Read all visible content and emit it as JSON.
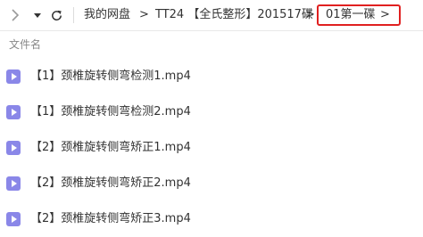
{
  "toolbar": {
    "forward_icon": "chevron-right-icon",
    "dropdown_icon": "caret-down-icon",
    "refresh_icon": "refresh-icon"
  },
  "breadcrumb": {
    "items": [
      "我的网盘",
      "TT24 【全氏整形】201517碟"
    ],
    "separator": ">",
    "current": "01第一碟",
    "current_arrow": ">",
    "highlight_color": "#e02020"
  },
  "header": {
    "column_name": "文件名"
  },
  "files": [
    {
      "name": "【1】颈椎旋转侧弯检测1.mp4"
    },
    {
      "name": "【1】颈椎旋转侧弯检测2.mp4"
    },
    {
      "name": "【2】颈椎旋转侧弯矫正1.mp4"
    },
    {
      "name": "【2】颈椎旋转侧弯矫正2.mp4"
    },
    {
      "name": "【2】颈椎旋转侧弯矫正3.mp4"
    }
  ],
  "colors": {
    "file_icon": "#8a87e8"
  }
}
